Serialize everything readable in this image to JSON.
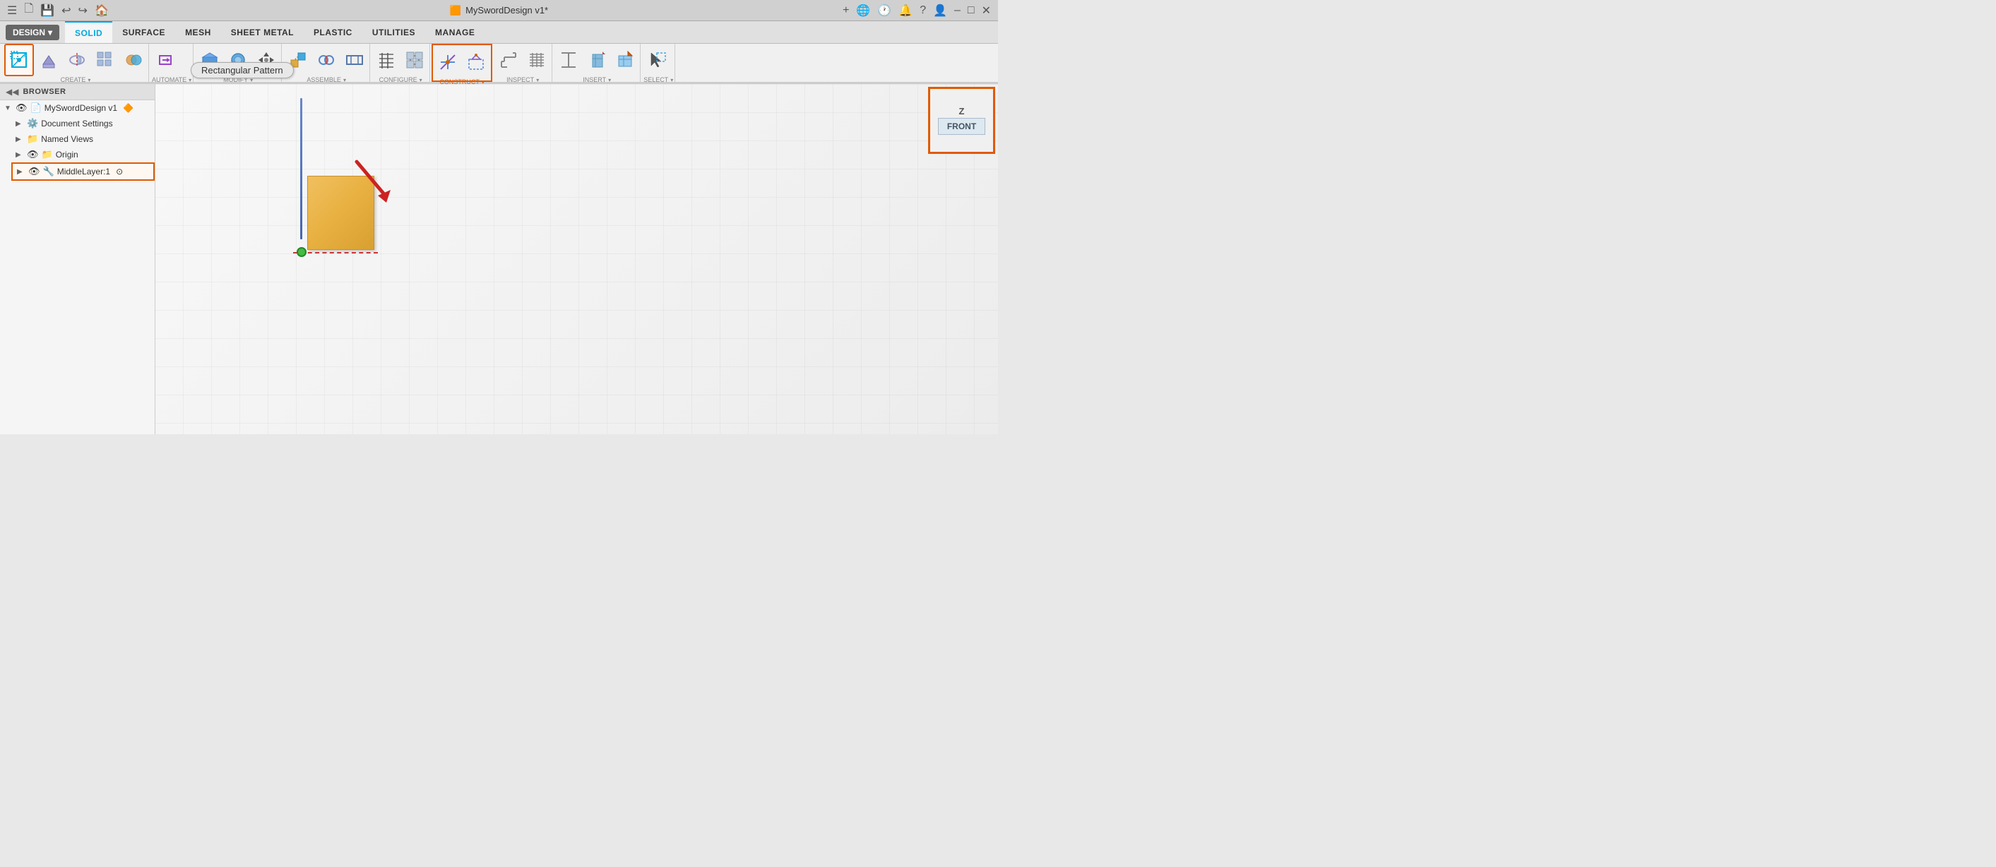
{
  "window": {
    "title": "MySwordDesign v1*",
    "title_icon": "🟧"
  },
  "titlebar": {
    "close_label": "✕",
    "min_label": "–",
    "max_label": "□",
    "new_tab_label": "+",
    "globe_icon": "🌐",
    "clock_icon": "🕐",
    "bell_icon": "🔔",
    "help_icon": "?",
    "user_icon": "👤"
  },
  "design_button": {
    "label": "DESIGN",
    "arrow": "▾"
  },
  "tabs": [
    {
      "id": "solid",
      "label": "SOLID",
      "active": true
    },
    {
      "id": "surface",
      "label": "SURFACE"
    },
    {
      "id": "mesh",
      "label": "MESH"
    },
    {
      "id": "sheet_metal",
      "label": "SHEET METAL"
    },
    {
      "id": "plastic",
      "label": "PLASTIC"
    },
    {
      "id": "utilities",
      "label": "UTILITIES"
    },
    {
      "id": "manage",
      "label": "MANAGE"
    }
  ],
  "toolbar_groups": [
    {
      "id": "create",
      "label": "CREATE",
      "has_dropdown": true,
      "items": [
        "sketch_icon",
        "extrude_icon",
        "revolve_icon",
        "pattern_icon",
        "combine_icon"
      ]
    },
    {
      "id": "automate",
      "label": "AUTOMATE",
      "has_dropdown": true,
      "items": [
        "automate_icon"
      ]
    },
    {
      "id": "modify",
      "label": "MODIFY",
      "has_dropdown": true,
      "items": [
        "modify1_icon",
        "modify2_icon",
        "move_icon"
      ]
    },
    {
      "id": "assemble",
      "label": "ASSEMBLE",
      "has_dropdown": true,
      "items": [
        "assemble1_icon",
        "assemble2_icon",
        "assemble3_icon"
      ]
    },
    {
      "id": "configure",
      "label": "CONFIGURE",
      "has_dropdown": true,
      "items": [
        "configure1_icon",
        "configure2_icon"
      ]
    },
    {
      "id": "construct",
      "label": "CONSTRUCT",
      "has_dropdown": true,
      "highlighted": true,
      "items": [
        "construct1_icon",
        "construct2_icon"
      ]
    },
    {
      "id": "inspect",
      "label": "INSPECT",
      "has_dropdown": true,
      "items": [
        "inspect1_icon",
        "inspect2_icon"
      ]
    },
    {
      "id": "insert",
      "label": "INSERT",
      "has_dropdown": true,
      "items": [
        "insert1_icon",
        "insert2_icon",
        "insert3_icon"
      ]
    },
    {
      "id": "select",
      "label": "SELECT",
      "has_dropdown": true,
      "items": [
        "select_icon"
      ]
    }
  ],
  "tooltip": {
    "label": "Rectangular Pattern"
  },
  "browser": {
    "title": "BROWSER",
    "collapse_icon": "◀◀",
    "items": [
      {
        "id": "root",
        "label": "MySwordDesign v1",
        "indent": 0,
        "has_arrow": true,
        "expanded": true,
        "icon": "📄",
        "badge": "🔶"
      },
      {
        "id": "doc_settings",
        "label": "Document Settings",
        "indent": 1,
        "has_arrow": true,
        "icon": "⚙️"
      },
      {
        "id": "named_views",
        "label": "Named Views",
        "indent": 1,
        "has_arrow": true,
        "icon": "📁"
      },
      {
        "id": "origin",
        "label": "Origin",
        "indent": 1,
        "has_arrow": true,
        "icon": "📁",
        "eye_icon": true
      },
      {
        "id": "middle_layer",
        "label": "MiddleLayer:1",
        "indent": 1,
        "has_arrow": true,
        "icon": "🔧",
        "highlighted": true,
        "eye_icon": true,
        "circle_icon": true
      }
    ]
  },
  "viewport": {
    "view_cube": {
      "z_label": "Z",
      "front_label": "FRONT"
    }
  }
}
